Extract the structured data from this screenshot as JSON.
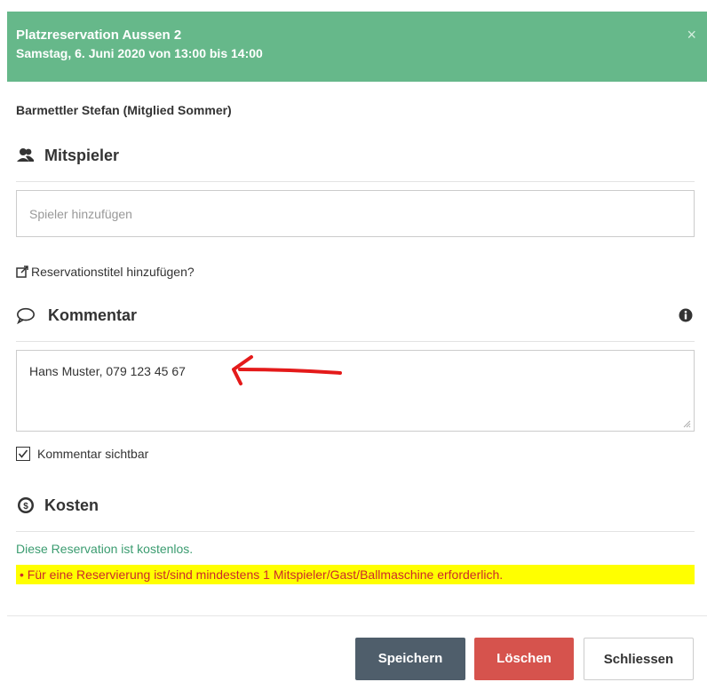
{
  "header": {
    "title": "Platzreservation Aussen 2",
    "subtitle": "Samstag, 6. Juni 2020 von 13:00 bis 14:00",
    "close_symbol": "×"
  },
  "member": "Barmettler Stefan (Mitglied Sommer)",
  "players": {
    "heading": "Mitspieler",
    "icon": "users-icon",
    "input_placeholder": "Spieler hinzufügen"
  },
  "title_link": {
    "icon": "external-link-icon",
    "label": "Reservationstitel hinzufügen?"
  },
  "comment": {
    "heading": "Kommentar",
    "icon": "speech-bubble-icon",
    "info_icon": "info-icon",
    "value": "Hans Muster, 079 123 45 67",
    "annotation": "red-arrow-annotation",
    "visible_label": "Kommentar sichtbar",
    "visible_checked": true
  },
  "costs": {
    "heading": "Kosten",
    "icon": "dollar-circle-icon",
    "text": "Diese Reservation ist kostenlos.",
    "warning": "Für eine Reservierung ist/sind mindestens 1 Mitspieler/Gast/Ballmaschine erforderlich.",
    "warning_bullet": "•"
  },
  "buttons": {
    "save": "Speichern",
    "delete": "Löschen",
    "close": "Schliessen"
  },
  "colors": {
    "header_bg": "#66b88a",
    "save_bg": "#4f5e6b",
    "delete_bg": "#d6534d",
    "cost_text": "#3b9c70",
    "warning_bg": "#ffff00",
    "warning_text": "#cc2a2a"
  }
}
